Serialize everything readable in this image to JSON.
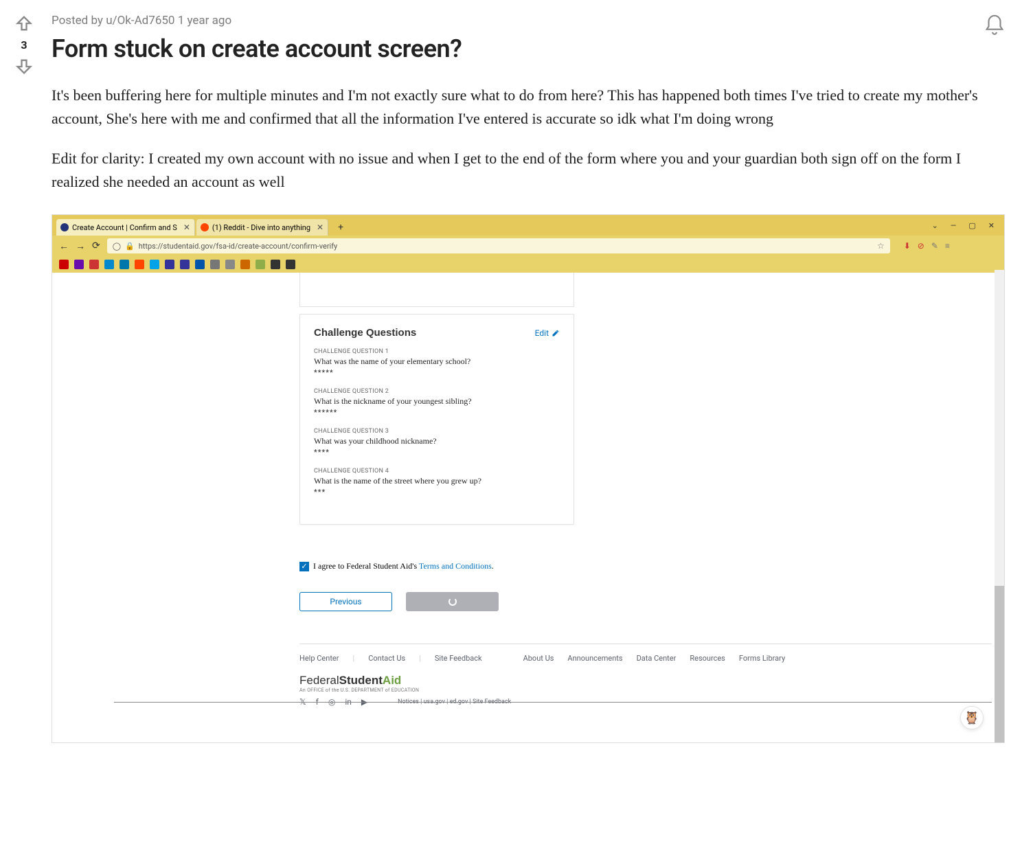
{
  "post": {
    "meta_prefix": "Posted by ",
    "author": "u/Ok-Ad7650",
    "age": "1 year ago",
    "score": "3",
    "title": "Form stuck on create account screen?",
    "body1": "It's been buffering here for multiple minutes and I'm not exactly sure what to do from here? This has happened both times I've tried to create my mother's account, She's here with me and confirmed that all the information I've entered is accurate so idk what I'm doing wrong",
    "body2": "Edit for clarity: I created my own account with no issue and when I get to the end of the form where you and your guardian both sign off on the form I realized she needed an account as well"
  },
  "browser": {
    "tabs": [
      {
        "title": "Create Account | Confirm and S",
        "icon_color": "#223377"
      },
      {
        "title": "(1) Reddit - Dive into anything",
        "icon_color": "#ff4500"
      }
    ],
    "url": "https://studentaid.gov/fsa-id/create-account/confirm-verify",
    "bookmark_colors": [
      "#cc0000",
      "#6a0dad",
      "#cc3333",
      "#0088cc",
      "#0077aa",
      "#ff4500",
      "#00a2e8",
      "#333399",
      "#333399",
      "#0055aa",
      "#777777",
      "#888888",
      "#cc6600",
      "#8fae4a",
      "#333333",
      "#333333"
    ]
  },
  "form": {
    "card_title": "Challenge Questions",
    "edit_label": "Edit",
    "questions": [
      {
        "label": "CHALLENGE QUESTION 1",
        "question": "What was the name of your elementary school?",
        "answer": "*****"
      },
      {
        "label": "CHALLENGE QUESTION 2",
        "question": "What is the nickname of your youngest sibling?",
        "answer": "******"
      },
      {
        "label": "CHALLENGE QUESTION 3",
        "question": "What was your childhood nickname?",
        "answer": "****"
      },
      {
        "label": "CHALLENGE QUESTION 4",
        "question": "What is the name of the street where you grew up?",
        "answer": "***"
      }
    ],
    "terms_prefix": "I agree to Federal Student Aid's ",
    "terms_link": "Terms and Conditions",
    "terms_suffix": ".",
    "previous_label": "Previous"
  },
  "footer": {
    "group1": [
      "Help Center",
      "Contact Us",
      "Site Feedback"
    ],
    "group2": [
      "About Us",
      "Announcements",
      "Data Center",
      "Resources",
      "Forms Library"
    ],
    "brand_thin": "Federal",
    "brand_bold": "Student",
    "brand_aid": "Aid",
    "brand_sub": "An OFFICE of the U.S. DEPARTMENT of EDUCATION",
    "social_glyphs": [
      "𝕏",
      "f",
      "◎",
      "in",
      "▶"
    ],
    "notices": "Notices  |  usa.gov  |  ed.gov  |  Site Feedback"
  }
}
